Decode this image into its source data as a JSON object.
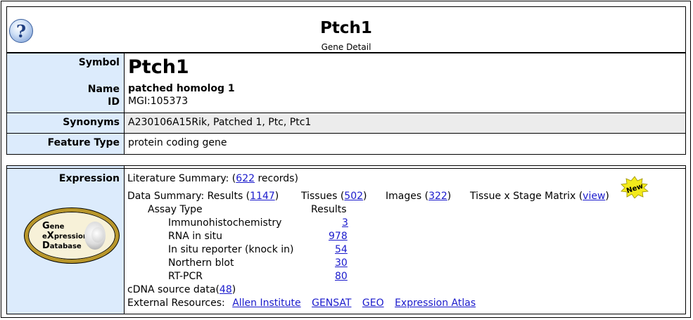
{
  "header": {
    "title": "Ptch1",
    "subtitle": "Gene Detail",
    "help_glyph": "?"
  },
  "detail": {
    "symbol_label": "Symbol",
    "symbol_value": "Ptch1",
    "name_label": "Name",
    "name_value": "patched homolog 1",
    "id_label": "ID",
    "id_value": "MGI:105373",
    "synonyms_label": "Synonyms",
    "synonyms_value": "A230106A15Rik, Patched 1, Ptc, Ptc1",
    "feature_type_label": "Feature Type",
    "feature_type_value": "protein coding gene"
  },
  "expression": {
    "label": "Expression",
    "logo": {
      "g_letter": "G",
      "g_rest": "ene",
      "e_pre": "e",
      "x_letter": "X",
      "e_rest": "pression",
      "d_letter": "D",
      "d_rest": "atabase"
    },
    "literature_summary_prefix": "Literature Summary: (",
    "literature_count": "622",
    "literature_suffix": " records)",
    "data_summary_prefix": "Data Summary: Results (",
    "results_count": "1147",
    "close_paren": ")",
    "tissues_prefix": "Tissues (",
    "tissues_count": "502",
    "images_prefix": "Images (",
    "images_count": "322",
    "matrix_prefix": "Tissue x Stage Matrix (",
    "matrix_link": "view",
    "new_badge": "New",
    "assay_type_header": "Assay Type",
    "results_header": "Results",
    "assays": [
      {
        "name": "Immunohistochemistry",
        "count": "3"
      },
      {
        "name": "RNA in situ",
        "count": "978"
      },
      {
        "name": "In situ reporter (knock in)",
        "count": "54"
      },
      {
        "name": "Northern blot",
        "count": "30"
      },
      {
        "name": "RT-PCR",
        "count": "80"
      }
    ],
    "cdna_prefix": "cDNA source data(",
    "cdna_count": "48",
    "external_label": "External Resources:",
    "external_links": [
      "Allen Institute",
      "GENSAT",
      "GEO",
      "Expression Atlas"
    ]
  },
  "colors": {
    "label_bg": "#dcebfc",
    "synonyms_band": "#ececec",
    "link": "#1a1acc",
    "badge": "#f3ea1c"
  }
}
